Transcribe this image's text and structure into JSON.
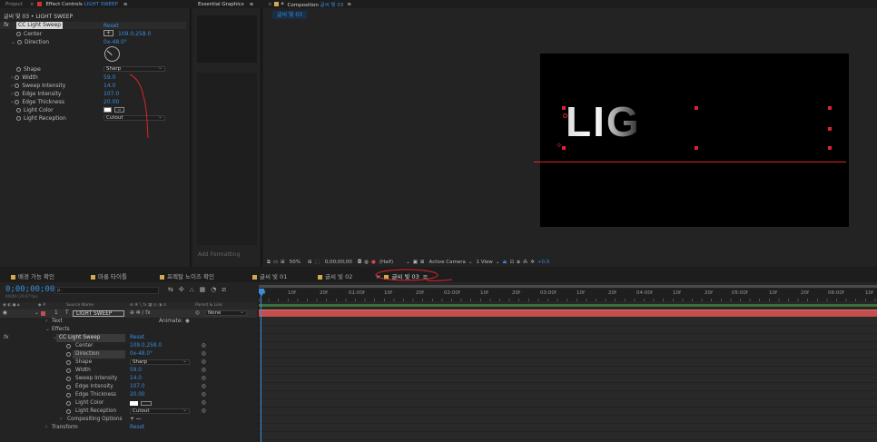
{
  "project_tabs": {
    "project": "Project",
    "effect_controls": "Effect Controls",
    "effect_layer": "LIGHT SWEEP"
  },
  "essential_graphics": {
    "title": "Essential Graphics"
  },
  "ec": {
    "breadcrumb": "글씨 빛 03 • LIGHT SWEEP",
    "effect": "CC Light Sweep",
    "reset": "Reset",
    "props": [
      {
        "label": "Center",
        "value": "109.0,258.0",
        "kind": "point"
      },
      {
        "label": "Direction",
        "value": "0x-48.0°",
        "kind": "angle"
      },
      {
        "label": "Shape",
        "value": "Sharp",
        "kind": "dropdown"
      },
      {
        "label": "Width",
        "value": "59.0"
      },
      {
        "label": "Sweep Intensity",
        "value": "14.0"
      },
      {
        "label": "Edge Intensity",
        "value": "107.0"
      },
      {
        "label": "Edge Thickness",
        "value": "20.00"
      },
      {
        "label": "Light Color",
        "value": "",
        "kind": "color"
      },
      {
        "label": "Light Reception",
        "value": "Cutout",
        "kind": "dropdown"
      }
    ]
  },
  "comp": {
    "tab_prefix": "Composition",
    "name": "글씨 빛 03",
    "subtab": "글씨 빛 03",
    "zoom": "50%",
    "timecode": "0;00;00;00",
    "resolution": "(Half)",
    "camera": "Active Camera",
    "view": "1 View",
    "exposure": "+0.0",
    "text_preview": "LIG"
  },
  "footer_text": "Add Formatting",
  "timeline": {
    "tabs": [
      "배경 가능 확인",
      "마롱 타이틀",
      "프렉탈 노이즈 확인",
      "글씨 빛 01",
      "글씨 빛 02",
      "글씨 빛 03"
    ],
    "timecode": "0;00;00;00",
    "fps": "00000 (29.97 fps)",
    "search_placeholder": "ρ..",
    "col_source": "Source Name",
    "col_parent": "Parent & Link",
    "layer": {
      "num": "1",
      "type": "T",
      "name": "LIGHT SWEEP",
      "parent": "None"
    },
    "tree": {
      "text": "Text",
      "animate": "Animate:",
      "effects": "Effects",
      "effect": "CC Light Sweep",
      "reset": "Reset",
      "compositing": "Compositing Options",
      "compositing_value": "+ —",
      "transform": "Transform",
      "transform_reset": "Reset"
    },
    "props": [
      {
        "label": "Center",
        "value": "109.0,258.0"
      },
      {
        "label": "Direction",
        "value": "0x-48.0°"
      },
      {
        "label": "Shape",
        "value": "Sharp",
        "kind": "dropdown"
      },
      {
        "label": "Width",
        "value": "59.0"
      },
      {
        "label": "Sweep Intensity",
        "value": "14.0"
      },
      {
        "label": "Edge Intensity",
        "value": "107.0"
      },
      {
        "label": "Edge Thickness",
        "value": "20.00"
      },
      {
        "label": "Light Color",
        "value": "",
        "kind": "color"
      },
      {
        "label": "Light Reception",
        "value": "Cutout",
        "kind": "dropdown"
      }
    ],
    "ruler": [
      "0f",
      "10f",
      "20f",
      "01:00f",
      "10f",
      "20f",
      "02:00f",
      "10f",
      "20f",
      "03:00f",
      "10f",
      "20f",
      "04:00f",
      "10f",
      "20f",
      "05:00f",
      "10f",
      "20f",
      "06:00f",
      "10f"
    ]
  },
  "colors": {
    "accent": "#3a8ddf",
    "annotation": "#e0232a",
    "layer_bar": "#c44d4d",
    "work_area": "#3c6f3c"
  }
}
